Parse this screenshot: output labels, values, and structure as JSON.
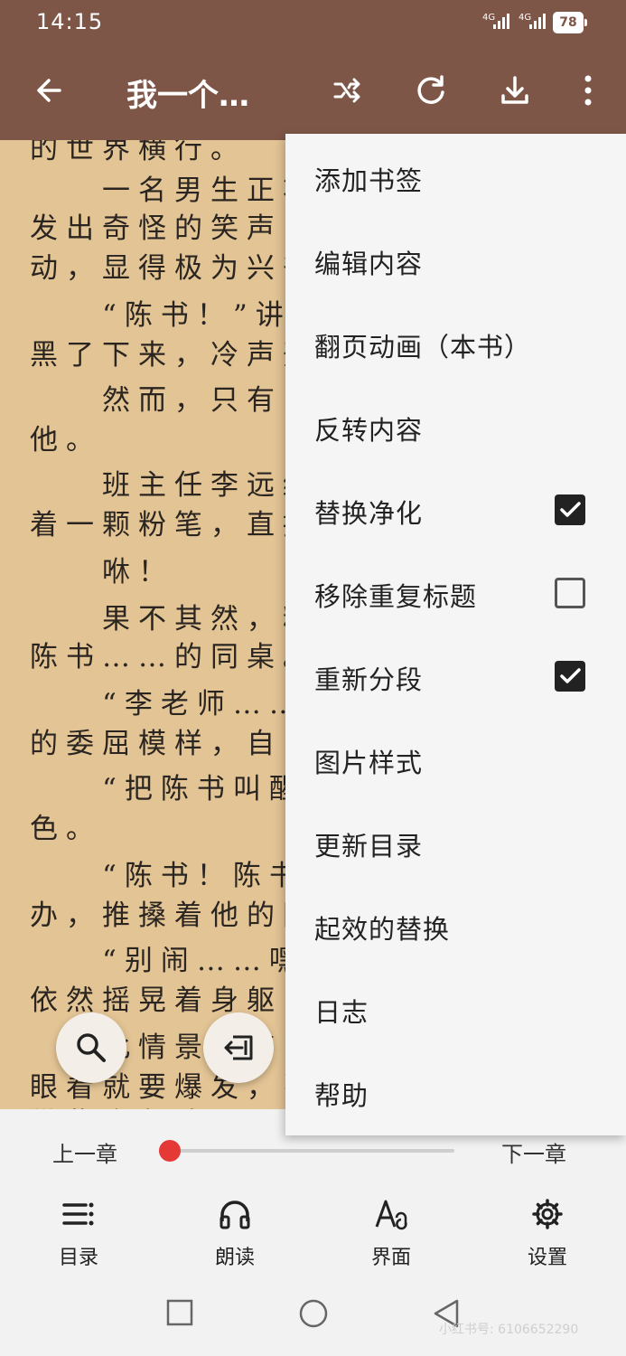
{
  "status_bar": {
    "time": "14:15",
    "signal1": "4G",
    "signal2": "4G",
    "battery": "78"
  },
  "app_bar": {
    "title": "我一个…"
  },
  "reader": {
    "lines": [
      "的世界横行。",
      "　　一名男生正将",
      "发出奇怪的笑声，",
      "动，显得极为兴奋",
      "　　“陈书！”讲",
      "黑了下来，冷声开",
      "　　然而，只有「",
      "他。",
      "　　班主任李远终",
      "着一颗粉笔，直接",
      "　　咻！",
      "　　果不其然，粉",
      "陈书……的同桌。",
      "　　“李老师……",
      "的委屈模样，自己",
      "　　“把陈书叫醒",
      "色。",
      "　　“陈书！陈书",
      "办，推搡着他的同",
      "　　“别闹……嘿",
      "依然摇晃着身躯，",
      "　　此情景，李",
      "眼看就要爆发，张",
      "带些许急迫。"
    ]
  },
  "menu": {
    "items": [
      {
        "label": "添加书签"
      },
      {
        "label": "编辑内容"
      },
      {
        "label": "翻页动画（本书）"
      },
      {
        "label": "反转内容"
      },
      {
        "label": "替换净化",
        "checked": true
      },
      {
        "label": "移除重复标题",
        "checked": false
      },
      {
        "label": "重新分段",
        "checked": true
      },
      {
        "label": "图片样式"
      },
      {
        "label": "更新目录"
      },
      {
        "label": "起效的替换"
      },
      {
        "label": "日志"
      },
      {
        "label": "帮助"
      }
    ]
  },
  "chapter_nav": {
    "prev": "上一章",
    "next": "下一章",
    "progress": 0.0
  },
  "bottom_nav": {
    "items": [
      {
        "label": "目录",
        "icon": "toc-icon"
      },
      {
        "label": "朗读",
        "icon": "headphones-icon"
      },
      {
        "label": "界面",
        "icon": "font-icon"
      },
      {
        "label": "设置",
        "icon": "gear-icon"
      }
    ]
  },
  "watermark": "小红书号: 6106652290",
  "colors": {
    "toolbar": "#7d5647",
    "page": "#e3c495",
    "accent": "#e53935",
    "menu_bg": "#f5f5f5"
  }
}
